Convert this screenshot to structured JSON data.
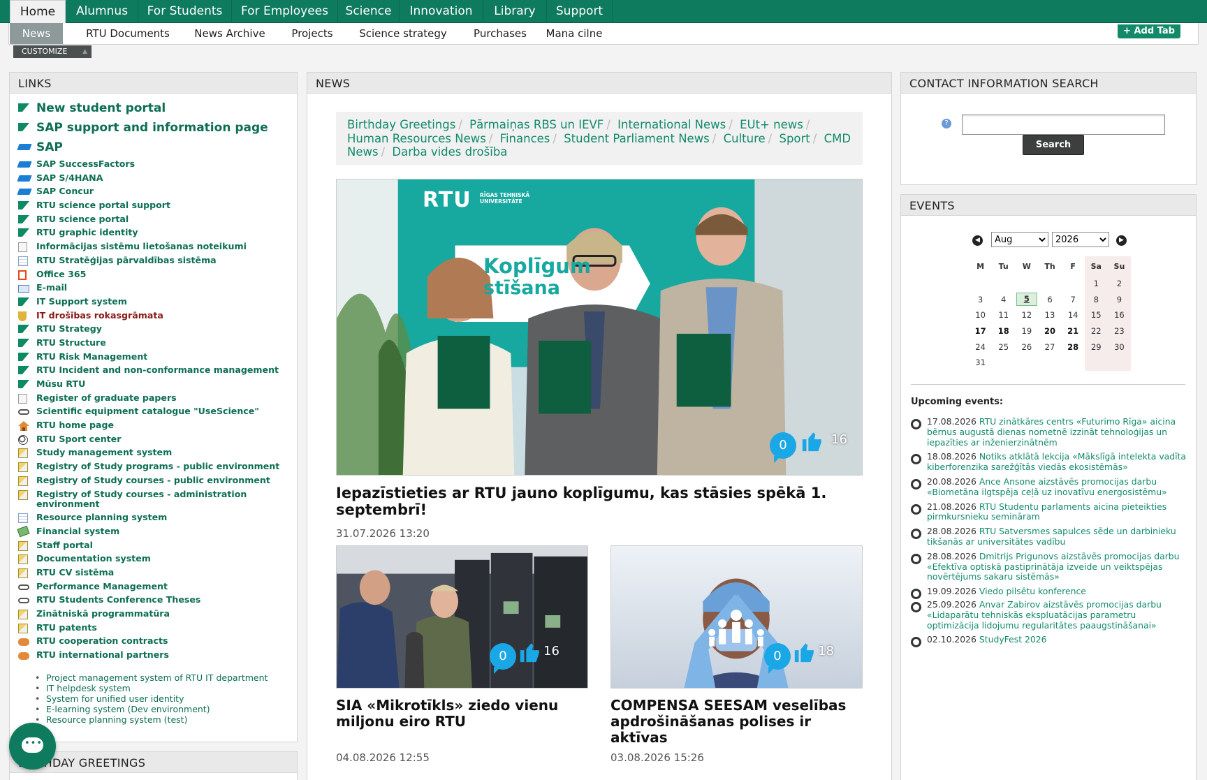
{
  "topnav": [
    "Home",
    "Alumnus",
    "For Students",
    "For Employees",
    "Science",
    "Innovation",
    "Library",
    "Support"
  ],
  "subnav": [
    "News",
    "RTU Documents",
    "News Archive",
    "Projects",
    "Science strategy",
    "Purchases",
    "Mana cilne"
  ],
  "add_tab": "+ Add Tab",
  "customize": "CUSTOMIZE",
  "links": {
    "title": "LINKS",
    "items": [
      {
        "label": "New student portal",
        "icon": "flag-icon"
      },
      {
        "label": "SAP support and information page",
        "icon": "flag-icon"
      },
      {
        "label": "SAP",
        "icon": "sap-icon"
      },
      {
        "label": "SAP SuccessFactors",
        "icon": "sap-icon"
      },
      {
        "label": "SAP S/4HANA",
        "icon": "sap-icon"
      },
      {
        "label": "SAP Concur",
        "icon": "sap-icon"
      },
      {
        "label": "RTU science portal support",
        "icon": "flag-icon"
      },
      {
        "label": "RTU science portal",
        "icon": "flag-icon"
      },
      {
        "label": "RTU graphic identity",
        "icon": "flag-icon"
      },
      {
        "label": "Informācijas sistēmu lietošanas noteikumi",
        "icon": "document-icon"
      },
      {
        "label": "RTU Stratēģijas pārvaldības sistēma",
        "icon": "form-icon"
      },
      {
        "label": "Office 365",
        "icon": "office-icon"
      },
      {
        "label": "E-mail",
        "icon": "mail-icon"
      },
      {
        "label": "IT Support system",
        "icon": "flag-icon"
      },
      {
        "label": "IT drošības rokasgrāmata",
        "icon": "shield-icon"
      },
      {
        "label": "RTU Strategy",
        "icon": "flag-icon"
      },
      {
        "label": "RTU Structure",
        "icon": "flag-icon"
      },
      {
        "label": "RTU Risk Management",
        "icon": "flag-icon"
      },
      {
        "label": "RTU Incident and non-conformance management",
        "icon": "flag-icon"
      },
      {
        "label": "Mūsu RTU",
        "icon": "flag-icon"
      },
      {
        "label": "Register of graduate papers",
        "icon": "document-icon"
      },
      {
        "label": "Scientific equipment catalogue \"UseScience\"",
        "icon": "chain-icon"
      },
      {
        "label": "RTU home page",
        "icon": "home-icon"
      },
      {
        "label": "RTU Sport center",
        "icon": "ball-icon"
      },
      {
        "label": "Study management system",
        "icon": "pencil-icon"
      },
      {
        "label": "Registry of Study programs - public environment",
        "icon": "pencil-icon"
      },
      {
        "label": "Registry of Study courses - public environment",
        "icon": "pencil-icon"
      },
      {
        "label": "Registry of Study courses - administration environment",
        "icon": "pencil-icon"
      },
      {
        "label": "Resource planning system",
        "icon": "form-icon"
      },
      {
        "label": "Financial system",
        "icon": "money-icon"
      },
      {
        "label": "Staff portal",
        "icon": "pencil-icon"
      },
      {
        "label": "Documentation system",
        "icon": "pencil-icon"
      },
      {
        "label": "RTU CV sistēma",
        "icon": "pencil-icon"
      },
      {
        "label": "Performance Management",
        "icon": "chain-icon"
      },
      {
        "label": "RTU Students Conference Theses",
        "icon": "chain-icon"
      },
      {
        "label": "Zinātniskā programmatūra",
        "icon": "pencil-icon"
      },
      {
        "label": "RTU patents",
        "icon": "pencil-icon"
      },
      {
        "label": "RTU cooperation contracts",
        "icon": "handshake-icon"
      },
      {
        "label": "RTU international partners",
        "icon": "handshake-icon"
      }
    ],
    "external": [
      "Project management system of RTU IT department",
      "IT helpdesk system",
      "System for unified user identity",
      "E-learning system (Dev environment)",
      "Resource planning system (test)"
    ]
  },
  "birthday": {
    "title": "BIRTHDAY GREETINGS"
  },
  "news": {
    "title": "NEWS",
    "categories": [
      "Birthday Greetings",
      "Pārmaiņas RBS un IEVF",
      "International News",
      "EUt+ news",
      "Human Resources News",
      "Finances",
      "Student Parliament News",
      "Culture",
      "Sport",
      "CMD News",
      "Darba vides drošība"
    ],
    "featured": {
      "title": "Iepazīstieties ar RTU jauno koplīgumu, kas stāsies spēkā 1. septembrī!",
      "date": "31.07.2026 13:20",
      "comments": "0",
      "likes": "16",
      "banner_logo": "RTU",
      "banner_logo_sub": "RĪGAS TEHNISKĀ UNIVERSITĀTE",
      "banner_text1": "Koplīgum",
      "banner_text2": "stīšana"
    },
    "cards": [
      {
        "title": "SIA «Mikrotīkls» ziedo vienu miljonu eiro RTU",
        "date": "04.08.2026 12:55",
        "comments": "0",
        "likes": "16"
      },
      {
        "title": "COMPENSA SEESAM veselības apdrošināšanas polises ir aktīvas",
        "date": "03.08.2026 15:26",
        "comments": "0",
        "likes": "18"
      }
    ]
  },
  "contact": {
    "title": "CONTACT INFORMATION SEARCH",
    "search_label": "Search",
    "input_value": ""
  },
  "events": {
    "title": "EVENTS",
    "month": "Aug",
    "year": "2026",
    "weekdays": [
      "M",
      "Tu",
      "W",
      "Th",
      "F",
      "Sa",
      "Su"
    ],
    "upcoming_title": "Upcoming events:",
    "list": [
      {
        "date": "17.08.2026",
        "text": "RTU zinātkāres centrs «Futurimo Rīga» aicina bērnus augustā dienas nometnē izzināt tehnoloģijas un iepazīties ar inženierzinātnēm"
      },
      {
        "date": "18.08.2026",
        "text": "Notiks atklātā lekcija «Mākslīgā intelekta vadīta kiberforenzika sarežģītās viedās ekosistēmās»"
      },
      {
        "date": "20.08.2026",
        "text": "Ance Ansone aizstāvēs promocijas darbu «Biometāna ilgtspēja ceļā uz inovatīvu energosistēmu»"
      },
      {
        "date": "21.08.2026",
        "text": "RTU Studentu parlaments aicina pieteikties pirmkursnieku semināram"
      },
      {
        "date": "28.08.2026",
        "text": "RTU Satversmes sapulces sēde un darbinieku tikšanās ar universitātes vadību"
      },
      {
        "date": "28.08.2026",
        "text": "Dmitrijs Prigunovs aizstāvēs promocijas darbu «Efektīva optiskā pastiprinātāja izveide un veiktspējas novērtējums sakaru sistēmās»"
      },
      {
        "date": "19.09.2026",
        "text": "Viedo pilsētu konference"
      },
      {
        "date": "25.09.2026",
        "text": "Anvar Zabirov aizstāvēs promocijas darbu «Lidaparātu tehniskās ekspluatācijas parametru optimizācija lidojumu regularitātes paaugstināšanai»"
      },
      {
        "date": "02.10.2026",
        "text": "StudyFest 2026"
      }
    ]
  },
  "colors": {
    "brand": "#0e7a5e",
    "link": "#0d6e54",
    "accent": "#19a7e6"
  }
}
